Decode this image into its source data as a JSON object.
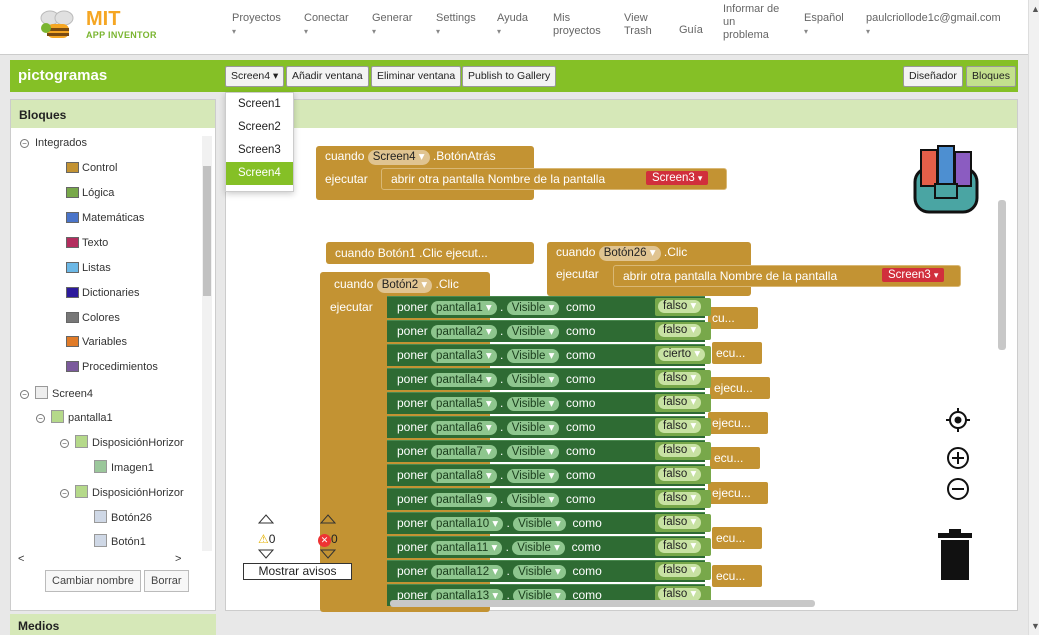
{
  "brand": {
    "line1": "MIT",
    "line2": "APP INVENTOR"
  },
  "menu": [
    {
      "label": "Proyectos",
      "caret": "▾"
    },
    {
      "label": "Conectar",
      "caret": "▾"
    },
    {
      "label": "Generar",
      "caret": "▾"
    },
    {
      "label": "Settings",
      "caret": "▾"
    },
    {
      "label": "Ayuda",
      "caret": "▾"
    },
    {
      "label": "Mis proyectos"
    },
    {
      "label": "View Trash"
    },
    {
      "label": "Guía"
    },
    {
      "label": "Informar de un problema"
    },
    {
      "label": "Español",
      "caret": "▾"
    },
    {
      "label": "paulcriollode1c@gmail.com",
      "caret": "▾"
    }
  ],
  "project": {
    "name": "pictogramas"
  },
  "toolbar": {
    "screen_select": "Screen4 ▾",
    "add_screen": "Añadir ventana",
    "remove_screen": "Eliminar ventana",
    "publish": "Publish to Gallery",
    "designer": "Diseñador",
    "blocks": "Bloques"
  },
  "screen_menu": [
    "Screen1",
    "Screen2",
    "Screen3",
    "Screen4"
  ],
  "blocks_panel": {
    "title": "Bloques",
    "builtin": "Integrados",
    "categories": [
      {
        "label": "Control",
        "color": "#c39333"
      },
      {
        "label": "Lógica",
        "color": "#78a84a"
      },
      {
        "label": "Matemáticas",
        "color": "#4a74c9"
      },
      {
        "label": "Texto",
        "color": "#b32d5e"
      },
      {
        "label": "Listas",
        "color": "#6cb8e6"
      },
      {
        "label": "Dictionaries",
        "color": "#2c1a9c"
      },
      {
        "label": "Colores",
        "color": "#777777"
      },
      {
        "label": "Variables",
        "color": "#e07b28"
      },
      {
        "label": "Procedimientos",
        "color": "#7b5a9c"
      }
    ],
    "tree": {
      "screen": "Screen4",
      "pantalla": "pantalla1",
      "h1": "DisposiciónHorizor",
      "img": "Imagen1",
      "h2": "DisposiciónHorizor",
      "b1": "Botón26",
      "b2": "Botón1"
    },
    "rename": "Cambiar nombre",
    "delete": "Borrar",
    "media": "Medios"
  },
  "workspace": {
    "w": "cuando",
    "do": "ejecutar",
    "open": "abrir otra pantalla",
    "screen_name": "Nombre de la pantalla",
    "screen3": "Screen3",
    "back_comp": "Screen4",
    "back_evt": ".BotónAtrás",
    "click": ".Clic",
    "btn26": "Botón26",
    "btn2": "Botón2",
    "collapsed": "cuando Botón1 .Clic ejecut...",
    "set": "poner",
    "visible": "Visible",
    "as": "como",
    "dot": ".",
    "rows": [
      {
        "comp": "pantalla1",
        "val": "falso"
      },
      {
        "comp": "pantalla2",
        "val": "falso"
      },
      {
        "comp": "pantalla3",
        "val": "cierto"
      },
      {
        "comp": "pantalla4",
        "val": "falso"
      },
      {
        "comp": "pantalla5",
        "val": "falso"
      },
      {
        "comp": "pantalla6",
        "val": "falso"
      },
      {
        "comp": "pantalla7",
        "val": "falso"
      },
      {
        "comp": "pantalla8",
        "val": "falso"
      },
      {
        "comp": "pantalla9",
        "val": "falso"
      },
      {
        "comp": "pantalla10",
        "val": "falso"
      },
      {
        "comp": "pantalla11",
        "val": "falso"
      },
      {
        "comp": "pantalla12",
        "val": "falso"
      },
      {
        "comp": "pantalla13",
        "val": "falso"
      }
    ],
    "peeks": [
      "cu...",
      "ecu...",
      "ejecu...",
      "ejecu...",
      "ejecu...",
      "ecu...",
      "ejecu...",
      "ecu...",
      "ecu..."
    ],
    "warnings": "0",
    "errors": "0",
    "show_warnings": "Mostrar avisos"
  }
}
